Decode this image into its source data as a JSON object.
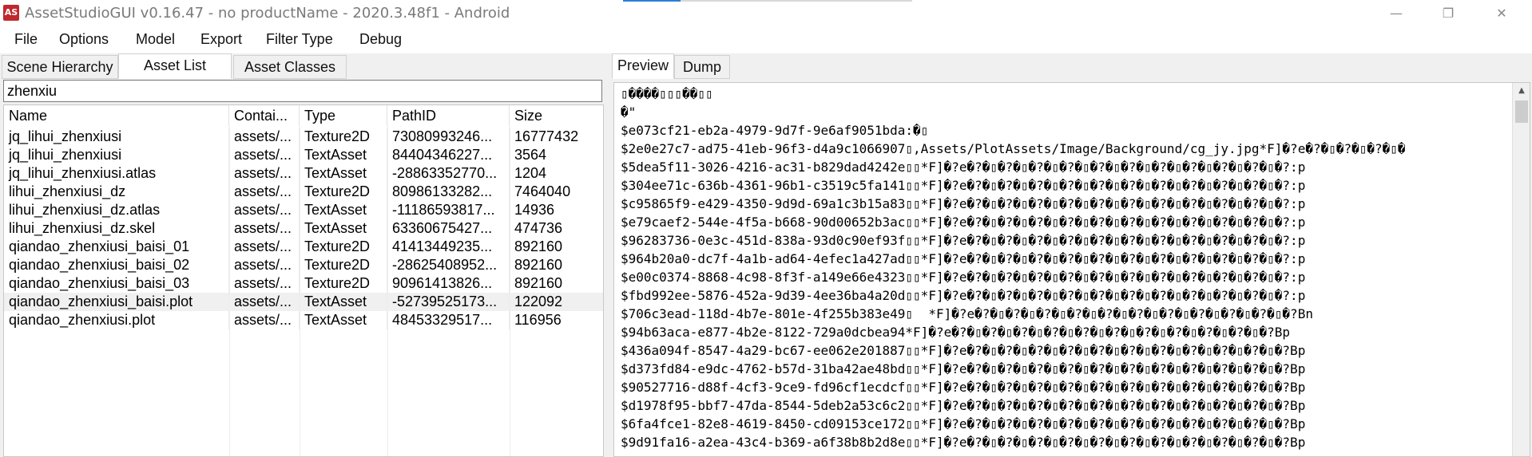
{
  "window": {
    "icon_text": "AS",
    "title": "AssetStudioGUI v0.16.47 - no productName - 2020.3.48f1 - Android",
    "minimize": "—",
    "maximize": "❐",
    "close": "✕"
  },
  "menu": [
    "File",
    "Options",
    "Model",
    "Export",
    "Filter Type",
    "Debug"
  ],
  "left_tabs": [
    "Scene Hierarchy",
    "Asset List",
    "Asset Classes"
  ],
  "active_left_tab": "Asset List",
  "search": {
    "value": "zhenxiu"
  },
  "columns": [
    "Name",
    "Contai...",
    "Type",
    "PathID",
    "Size"
  ],
  "rows": [
    {
      "name": "jq_lihui_zhenxiusi",
      "container": "assets/...",
      "type": "Texture2D",
      "pathid": "73080993246...",
      "size": "16777432"
    },
    {
      "name": "jq_lihui_zhenxiusi",
      "container": "assets/...",
      "type": "TextAsset",
      "pathid": "84404346227...",
      "size": "3564"
    },
    {
      "name": "jq_lihui_zhenxiusi.atlas",
      "container": "assets/...",
      "type": "TextAsset",
      "pathid": "-28863352770...",
      "size": "1204"
    },
    {
      "name": "lihui_zhenxiusi_dz",
      "container": "assets/...",
      "type": "Texture2D",
      "pathid": "80986133282...",
      "size": "7464040"
    },
    {
      "name": "lihui_zhenxiusi_dz.atlas",
      "container": "assets/...",
      "type": "TextAsset",
      "pathid": "-11186593817...",
      "size": "14936"
    },
    {
      "name": "lihui_zhenxiusi_dz.skel",
      "container": "assets/...",
      "type": "TextAsset",
      "pathid": "63360675427...",
      "size": "474736"
    },
    {
      "name": "qiandao_zhenxiusi_baisi_01",
      "container": "assets/...",
      "type": "Texture2D",
      "pathid": "41413449235...",
      "size": "892160"
    },
    {
      "name": "qiandao_zhenxiusi_baisi_02",
      "container": "assets/...",
      "type": "Texture2D",
      "pathid": "-28625408952...",
      "size": "892160"
    },
    {
      "name": "qiandao_zhenxiusi_baisi_03",
      "container": "assets/...",
      "type": "Texture2D",
      "pathid": "90961413826...",
      "size": "892160"
    },
    {
      "name": "qiandao_zhenxiusi_baisi.plot",
      "container": "assets/...",
      "type": "TextAsset",
      "pathid": "-52739525173...",
      "size": "122092"
    },
    {
      "name": "qiandao_zhenxiusi.plot",
      "container": "assets/...",
      "type": "TextAsset",
      "pathid": "48453329517...",
      "size": "116956"
    }
  ],
  "selected_row": 9,
  "right_tabs": [
    "Preview",
    "Dump"
  ],
  "active_right_tab": "Preview",
  "preview_lines": [
    "▯����▯▯▯��▯▯",
    "�\"",
    "$e073cf21-eb2a-4979-9d7f-9e6af9051bda:�▯",
    "$2e0e27c7-ad75-41eb-96f3-d4a9c1066907▯,Assets/PlotAssets/Image/Background/cg_jy.jpg*F]�?e�?�▯�?�▯�?�▯�",
    "$5dea5f11-3026-4216-ac31-b829dad4242e▯▯*F]�?e�?�▯�?�▯�?�▯�?�▯�?�▯�?�▯�?�▯�?�▯�?�▯�?�▯�?:p",
    "$304ee71c-636b-4361-96b1-c3519c5fa141▯▯*F]�?e�?�▯�?�▯�?�▯�?�▯�?�▯�?�▯�?�▯�?�▯�?�▯�?�▯�?:p",
    "$c95865f9-e429-4350-9d9d-69a1c3b15a83▯▯*F]�?e�?�▯�?�▯�?�▯�?�▯�?�▯�?�▯�?�▯�?�▯�?�▯�?�▯�?:p",
    "$e79caef2-544e-4f5a-b668-90d00652b3ac▯▯*F]�?e�?�▯�?�▯�?�▯�?�▯�?�▯�?�▯�?�▯�?�▯�?�▯�?�▯�?:p",
    "$96283736-0e3c-451d-838a-93d0c90ef93f▯▯*F]�?e�?�▯�?�▯�?�▯�?�▯�?�▯�?�▯�?�▯�?�▯�?�▯�?�▯�?:p",
    "$964b20a0-dc7f-4a1b-ad64-4efec1a427ad▯▯*F]�?e�?�▯�?�▯�?�▯�?�▯�?�▯�?�▯�?�▯�?�▯�?�▯�?�▯�?:p",
    "$e00c0374-8868-4c98-8f3f-a149e66e4323▯▯*F]�?e�?�▯�?�▯�?�▯�?�▯�?�▯�?�▯�?�▯�?�▯�?�▯�?�▯�?:p",
    "$fbd992ee-5876-452a-9d39-4ee36ba4a20d▯▯*F]�?e�?�▯�?�▯�?�▯�?�▯�?�▯�?�▯�?�▯�?�▯�?�▯�?�▯�?:p",
    "$706c3ead-118d-4b7e-801e-4f255b383e49▯  *F]�?e�?�▯�?�▯�?�▯�?�▯�?�▯�?�▯�?�▯�?�▯�?�▯�?�▯�?Bn",
    "$94b63aca-e877-4b2e-8122-729a0dcbea94*F]�?e�?�▯�?�▯�?�▯�?�▯�?�▯�?�▯�?�▯�?�▯�?�▯�?�▯�?Bp",
    "$436a094f-8547-4a29-bc67-ee062e201887▯▯*F]�?e�?�▯�?�▯�?�▯�?�▯�?�▯�?�▯�?�▯�?�▯�?�▯�?�▯�?Bp",
    "$d373fd84-e9dc-4762-b57d-31ba42ae48bd▯▯*F]�?e�?�▯�?�▯�?�▯�?�▯�?�▯�?�▯�?�▯�?�▯�?�▯�?�▯�?Bp",
    "$90527716-d88f-4cf3-9ce9-fd96cf1ecdcf▯▯*F]�?e�?�▯�?�▯�?�▯�?�▯�?�▯�?�▯�?�▯�?�▯�?�▯�?�▯�?Bp",
    "$d1978f95-bbf7-47da-8544-5deb2a53c6c2▯▯*F]�?e�?�▯�?�▯�?�▯�?�▯�?�▯�?�▯�?�▯�?�▯�?�▯�?�▯�?Bp",
    "$6fa4fce1-82e8-4619-8450-cd09153ce172▯▯*F]�?e�?�▯�?�▯�?�▯�?�▯�?�▯�?�▯�?�▯�?�▯�?�▯�?�▯�?Bp",
    "$9d91fa16-a2ea-43c4-b369-a6f38b8b2d8e▯▯*F]�?e�?�▯�?�▯�?�▯�?�▯�?�▯�?�▯�?�▯�?�▯�?�▯�?�▯�?Bp"
  ],
  "scroll": {
    "up": "▲",
    "down": "▼"
  }
}
